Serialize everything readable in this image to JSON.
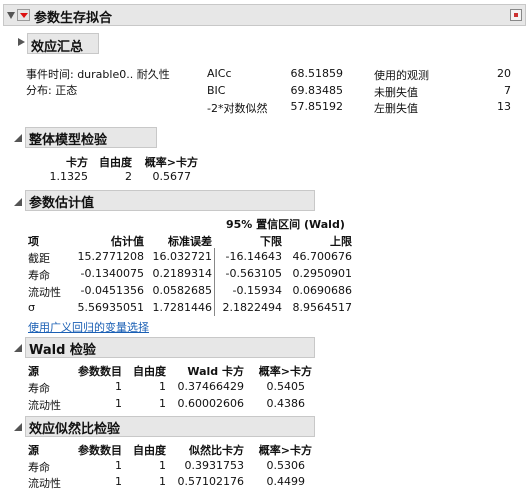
{
  "main": {
    "title": "参数生存拟合",
    "effect_summary_title": "效应汇总"
  },
  "info": {
    "event_time": "事件时间: durable0.. 耐久性",
    "distribution": "分布: 正态",
    "stats": [
      {
        "label": "AICc",
        "value": "68.51859",
        "label2": "使用的观测",
        "value2": "20"
      },
      {
        "label": "BIC",
        "value": "69.83485",
        "label2": "未删失值",
        "value2": "7"
      },
      {
        "label": "-2*对数似然",
        "value": "57.85192",
        "label2": "左删失值",
        "value2": "13"
      }
    ]
  },
  "whole_model": {
    "title": "整体模型检验",
    "headers": [
      "卡方",
      "自由度",
      "概率>卡方"
    ],
    "row": [
      "1.1325",
      "2",
      "0.5677"
    ]
  },
  "param_est": {
    "title": "参数估计值",
    "ci_header": "95% 置信区间 (Wald)",
    "headers": [
      "项",
      "估计值",
      "标准误差",
      "下限",
      "上限"
    ],
    "rows": [
      [
        "截距",
        "15.2771208",
        "16.032721",
        "-16.14643",
        "46.700676"
      ],
      [
        "寿命",
        "-0.1340075",
        "0.2189314",
        "-0.563105",
        "0.2950901"
      ],
      [
        "流动性",
        "-0.0451356",
        "0.0582685",
        "-0.15934",
        "0.0690686"
      ],
      [
        "σ",
        "5.56935051",
        "1.7281446",
        "2.1822494",
        "8.9564517"
      ]
    ],
    "link": "使用广义回归的变量选择"
  },
  "wald": {
    "title": "Wald 检验",
    "headers": [
      "源",
      "参数数目",
      "自由度",
      "Wald 卡方",
      "概率>卡方"
    ],
    "rows": [
      [
        "寿命",
        "1",
        "1",
        "0.37466429",
        "0.5405"
      ],
      [
        "流动性",
        "1",
        "1",
        "0.60002606",
        "0.4386"
      ]
    ]
  },
  "lr": {
    "title": "效应似然比检验",
    "headers": [
      "源",
      "参数数目",
      "自由度",
      "似然比卡方",
      "概率>卡方"
    ],
    "rows": [
      [
        "寿命",
        "1",
        "1",
        "0.3931753",
        "0.5306"
      ],
      [
        "流动性",
        "1",
        "1",
        "0.57102176",
        "0.4499"
      ]
    ]
  }
}
